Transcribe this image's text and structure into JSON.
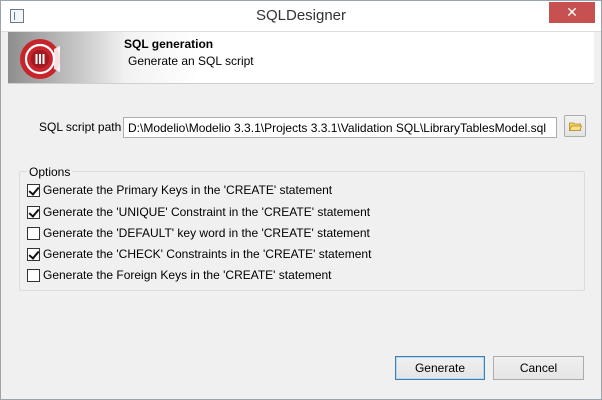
{
  "window": {
    "title": "SQLDesigner",
    "close_glyph": "✕"
  },
  "banner": {
    "title": "SQL generation",
    "subtitle": "Generate an SQL script",
    "logo_icon": "modelio-logo-icon"
  },
  "path": {
    "label": "SQL script path",
    "value": "D:\\Modelio\\Modelio 3.3.1\\Projects 3.3.1\\Validation SQL\\LibraryTablesModel.sql",
    "browse_icon": "folder-open-icon"
  },
  "options": {
    "title": "Options",
    "items": [
      {
        "label": "Generate the Primary Keys in the 'CREATE' statement",
        "checked": true
      },
      {
        "label": "Generate the 'UNIQUE' Constraint in the 'CREATE' statement",
        "checked": true
      },
      {
        "label": "Generate the 'DEFAULT' key word in the 'CREATE' statement",
        "checked": false
      },
      {
        "label": "Generate the 'CHECK' Constraints in the 'CREATE' statement",
        "checked": true
      },
      {
        "label": "Generate the Foreign Keys in the 'CREATE' statement",
        "checked": false
      }
    ]
  },
  "buttons": {
    "generate_label": "Generate",
    "cancel_label": "Cancel"
  },
  "colors": {
    "close_button": "#c75050",
    "logo_red": "#c8242b",
    "default_button_border": "#3c7fb1"
  }
}
